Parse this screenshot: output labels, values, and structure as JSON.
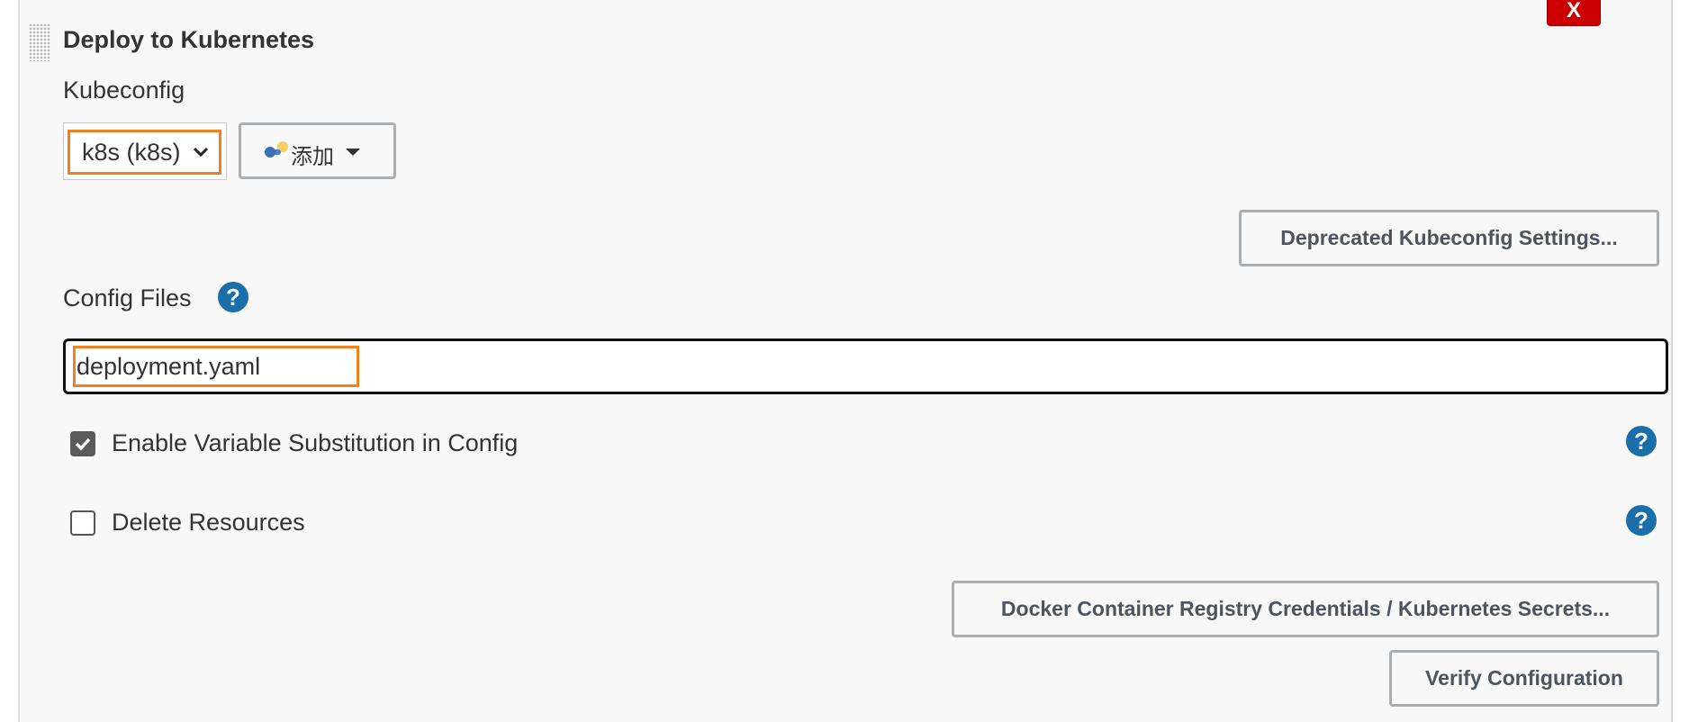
{
  "section": {
    "title": "Deploy to Kubernetes",
    "close_label": "X"
  },
  "kubeconfig": {
    "label": "Kubeconfig",
    "selected": "k8s (k8s)",
    "add_label": "添加"
  },
  "buttons": {
    "deprecated": "Deprecated Kubeconfig Settings...",
    "docker": "Docker Container Registry Credentials / Kubernetes Secrets...",
    "verify": "Verify Configuration"
  },
  "config_files": {
    "label": "Config Files",
    "value": "deployment.yaml"
  },
  "help_glyph": "?",
  "options": {
    "enable_substitution": {
      "label": "Enable Variable Substitution in Config",
      "checked": true
    },
    "delete_resources": {
      "label": "Delete Resources",
      "checked": false
    }
  },
  "colors": {
    "highlight": "#f0811e",
    "help": "#1a6faa",
    "close": "#cc0000"
  },
  "icons": [
    "drag-handle-icon",
    "close-icon",
    "chevron-down-icon",
    "key-icon",
    "caret-down-icon",
    "help-icon",
    "checkmark-icon"
  ]
}
